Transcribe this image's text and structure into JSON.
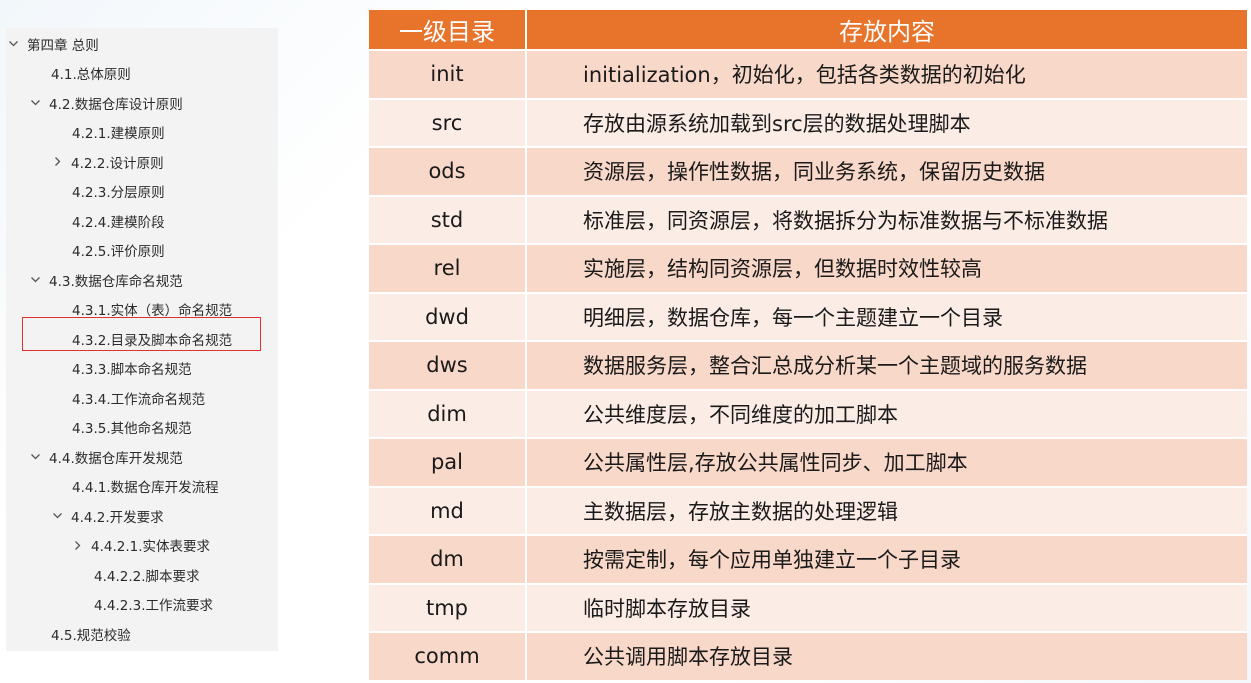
{
  "tree": {
    "items": [
      {
        "label": "第四章 总则",
        "toggle": "expanded"
      },
      {
        "label": "4.1.总体原则",
        "toggle": "none"
      },
      {
        "label": "4.2.数据仓库设计原则",
        "toggle": "expanded"
      },
      {
        "label": "4.2.1.建模原则",
        "toggle": "none"
      },
      {
        "label": "4.2.2.设计原则",
        "toggle": "collapsed"
      },
      {
        "label": "4.2.3.分层原则",
        "toggle": "none"
      },
      {
        "label": "4.2.4.建模阶段",
        "toggle": "none"
      },
      {
        "label": "4.2.5.评价原则",
        "toggle": "none"
      },
      {
        "label": "4.3.数据仓库命名规范",
        "toggle": "expanded"
      },
      {
        "label": "4.3.1.实体（表）命名规范",
        "toggle": "none"
      },
      {
        "label": "4.3.2.目录及脚本命名规范",
        "toggle": "none",
        "highlighted": true
      },
      {
        "label": "4.3.3.脚本命名规范",
        "toggle": "none"
      },
      {
        "label": "4.3.4.工作流命名规范",
        "toggle": "none"
      },
      {
        "label": "4.3.5.其他命名规范",
        "toggle": "none"
      },
      {
        "label": "4.4.数据仓库开发规范",
        "toggle": "expanded"
      },
      {
        "label": "4.4.1.数据仓库开发流程",
        "toggle": "none"
      },
      {
        "label": "4.4.2.开发要求",
        "toggle": "expanded"
      },
      {
        "label": "4.4.2.1.实体表要求",
        "toggle": "collapsed"
      },
      {
        "label": "4.4.2.2.脚本要求",
        "toggle": "none"
      },
      {
        "label": "4.4.2.3.工作流要求",
        "toggle": "none"
      },
      {
        "label": "4.5.规范校验",
        "toggle": "none"
      }
    ],
    "highlight_color": "#e0332f"
  },
  "table": {
    "headers": [
      "一级目录",
      "存放内容"
    ],
    "rows": [
      [
        "init",
        "initialization，初始化，包括各类数据的初始化"
      ],
      [
        "src",
        "存放由源系统加载到src层的数据处理脚本"
      ],
      [
        "ods",
        "资源层，操作性数据，同业务系统，保留历史数据"
      ],
      [
        "std",
        "标准层，同资源层，将数据拆分为标准数据与不标准数据"
      ],
      [
        "rel",
        "实施层，结构同资源层，但数据时效性较高"
      ],
      [
        "dwd",
        "明细层，数据仓库，每一个主题建立一个目录"
      ],
      [
        "dws",
        "数据服务层，整合汇总成分析某一个主题域的服务数据"
      ],
      [
        "dim",
        "公共维度层，不同维度的加工脚本"
      ],
      [
        "pal",
        "公共属性层,存放公共属性同步、加工脚本"
      ],
      [
        "md",
        "主数据层，存放主数据的处理逻辑"
      ],
      [
        "dm",
        "按需定制，每个应用单独建立一个子目录"
      ],
      [
        "tmp",
        "临时脚本存放目录"
      ],
      [
        "comm",
        "公共调用脚本存放目录"
      ]
    ],
    "colors": {
      "header": "#e8732a",
      "row_odd": "#f8d8c8",
      "row_even": "#fbece5"
    }
  }
}
